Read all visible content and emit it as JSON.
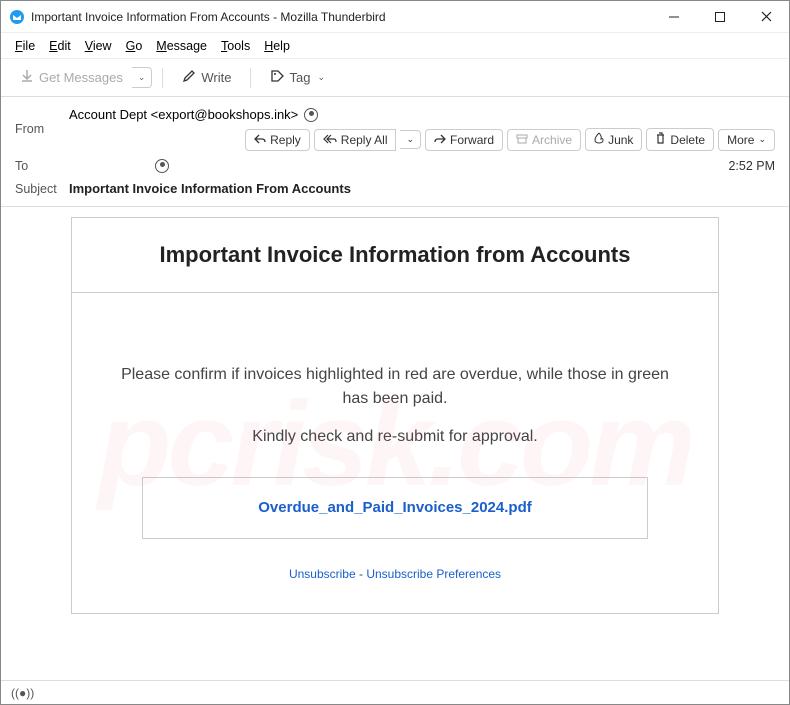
{
  "window": {
    "title": "Important Invoice Information From Accounts - Mozilla Thunderbird"
  },
  "menubar": {
    "file": "File",
    "edit": "Edit",
    "view": "View",
    "go": "Go",
    "message": "Message",
    "tools": "Tools",
    "help": "Help"
  },
  "toolbar": {
    "get_messages": "Get Messages",
    "write": "Write",
    "tag": "Tag"
  },
  "headers": {
    "from_label": "From",
    "from_value": "Account Dept <export@bookshops.ink>",
    "to_label": "To",
    "to_value": " ",
    "subject_label": "Subject",
    "subject_value": "Important Invoice Information From Accounts",
    "time": "2:52 PM"
  },
  "actions": {
    "reply": "Reply",
    "reply_all": "Reply All",
    "forward": "Forward",
    "archive": "Archive",
    "junk": "Junk",
    "delete": "Delete",
    "more": "More"
  },
  "email": {
    "heading": "Important Invoice Information from Accounts",
    "p1": "Please confirm if invoices highlighted in red are overdue, while those in green has been paid.",
    "p2": "Kindly check and re-submit for approval.",
    "attachment": "Overdue_and_Paid_Invoices_2024.pdf",
    "unsubscribe": "Unsubscribe",
    "sep": " - ",
    "unsub_prefs": "Unsubscribe Preferences"
  },
  "watermark": "pcrisk.com"
}
